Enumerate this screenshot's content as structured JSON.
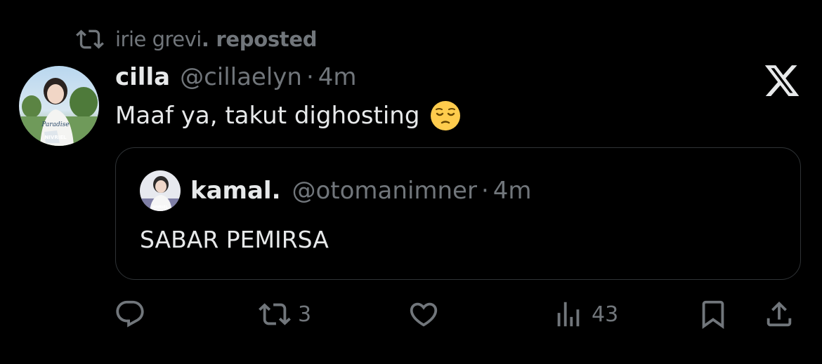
{
  "social_context": {
    "reposter": "irie grevi",
    "suffix": ". reposted"
  },
  "post": {
    "author_name": "cilla",
    "author_handle": "@cillaelyn",
    "separator": "·",
    "time": "4m",
    "text": "Maaf ya, takut dighosting",
    "emoji": "pensive-face",
    "platform_logo": "x-logo"
  },
  "quoted_post": {
    "author_name": "kamal.",
    "author_handle": "@otomanimner",
    "separator": "·",
    "time": "4m",
    "text": "SABAR PEMIRSA"
  },
  "actions": {
    "reply": {
      "icon": "reply-icon",
      "count": ""
    },
    "repost": {
      "icon": "repost-icon",
      "count": "3"
    },
    "like": {
      "icon": "like-icon",
      "count": ""
    },
    "views": {
      "icon": "views-icon",
      "count": "43"
    },
    "bookmark": {
      "icon": "bookmark-icon"
    },
    "share": {
      "icon": "share-icon"
    }
  },
  "colors": {
    "background": "#000000",
    "primary_text": "#e7e9ea",
    "secondary_text": "#71767b",
    "border": "#2f3336"
  }
}
